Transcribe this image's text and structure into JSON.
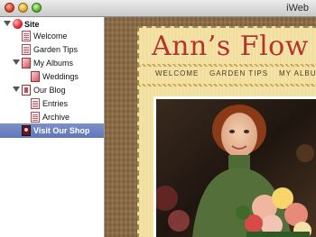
{
  "window": {
    "app_title": "iWeb"
  },
  "sidebar": {
    "items": [
      {
        "label": "Site",
        "icon": "site-icon"
      },
      {
        "label": "Welcome",
        "icon": "page-icon"
      },
      {
        "label": "Garden Tips",
        "icon": "page-icon"
      },
      {
        "label": "My Albums",
        "icon": "albums-icon"
      },
      {
        "label": "Weddings",
        "icon": "album-icon"
      },
      {
        "label": "Our Blog",
        "icon": "blog-icon"
      },
      {
        "label": "Entries",
        "icon": "entries-icon"
      },
      {
        "label": "Archive",
        "icon": "archive-icon"
      },
      {
        "label": "Visit Our Shop",
        "icon": "shop-icon",
        "selected": true
      }
    ]
  },
  "page": {
    "title": "Ann’s Flow",
    "nav": [
      "WELCOME",
      "GARDEN TIPS",
      "MY ALBUM"
    ]
  },
  "colors": {
    "accent_red": "#b5332b",
    "selection_blue": "#6a7fbe",
    "page_background": "#f3e2a4",
    "wood_background": "#8a6a43"
  }
}
